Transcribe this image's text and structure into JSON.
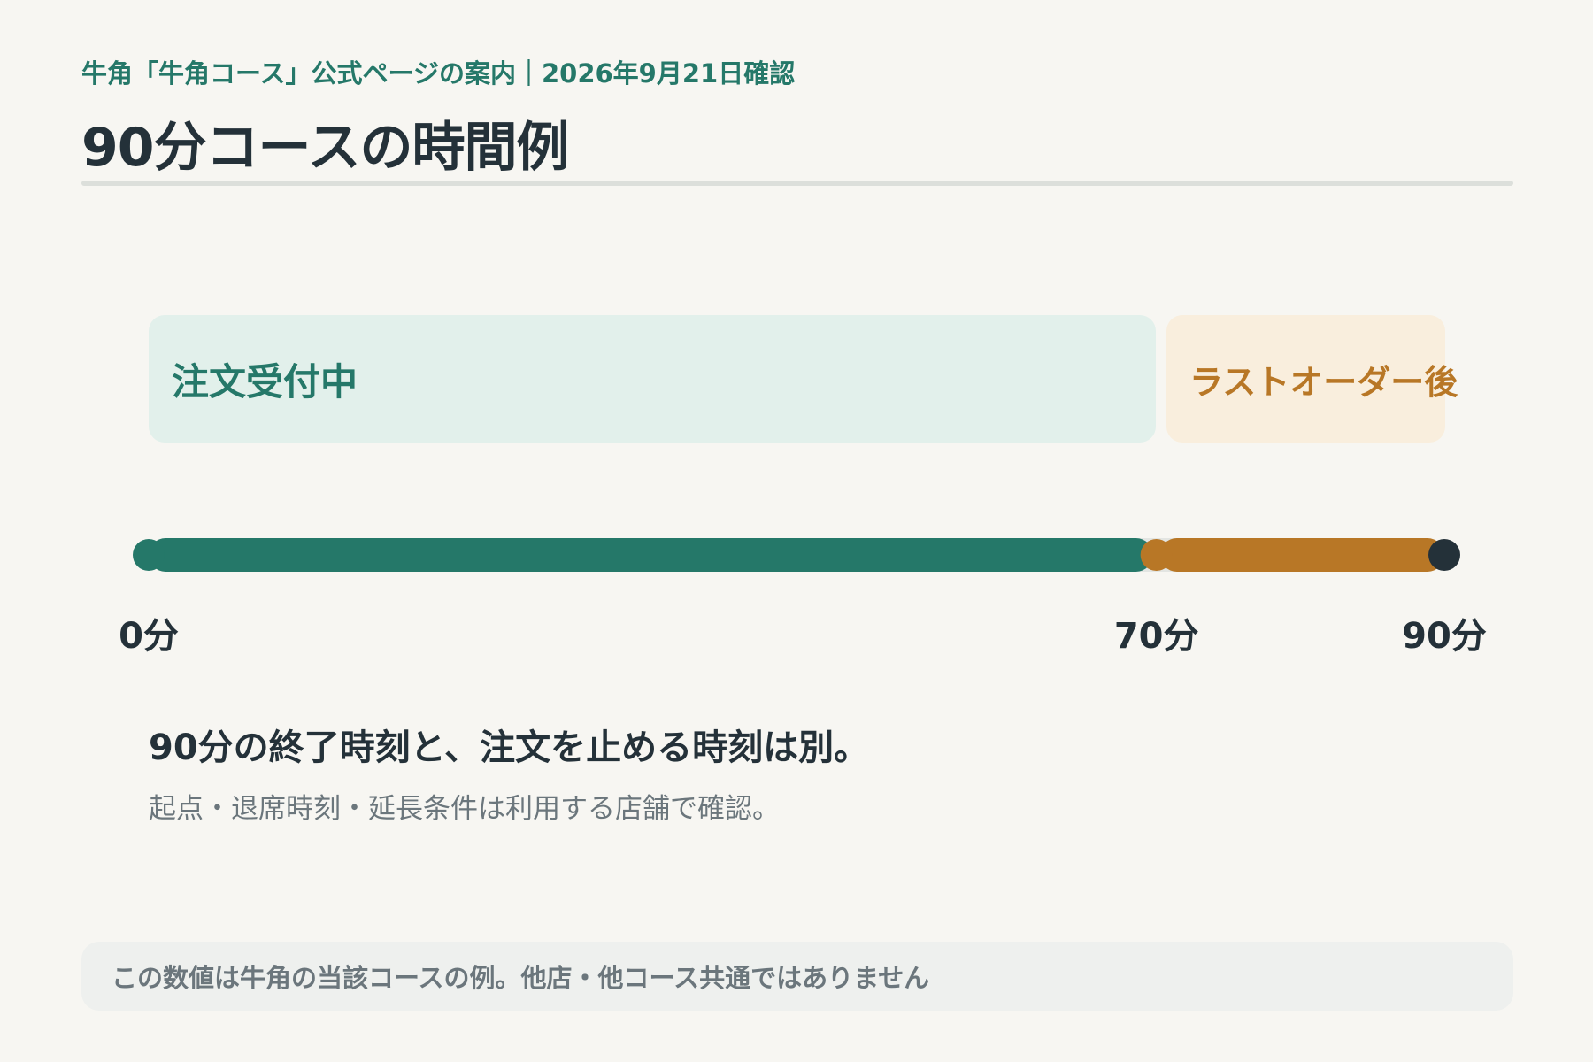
{
  "header": {
    "source": "牛角「牛角コース」公式ページの案内｜2026年9月21日確認",
    "title": "90分コースの時間例"
  },
  "chart_data": {
    "type": "timeline",
    "unit": "分",
    "range": [
      0,
      90
    ],
    "phases": [
      {
        "label": "注文受付中",
        "start": 0,
        "end": 70,
        "color": "#257869",
        "bg": "#e2f0eb"
      },
      {
        "label": "ラストオーダー後",
        "start": 70,
        "end": 90,
        "color": "#b87726",
        "bg": "#f9eedd"
      }
    ],
    "markers": [
      {
        "value": 0,
        "label": "0分",
        "color": "#257869"
      },
      {
        "value": 70,
        "label": "70分",
        "color": "#b87726"
      },
      {
        "value": 90,
        "label": "90分",
        "color": "#243139"
      }
    ]
  },
  "notes": {
    "main": "90分の終了時刻と、注文を止める時刻は別。",
    "sub": "起点・退席時刻・延長条件は利用する店舗で確認。"
  },
  "disclaimer": "この数値は牛角の当該コースの例。他店・他コース共通ではありません"
}
